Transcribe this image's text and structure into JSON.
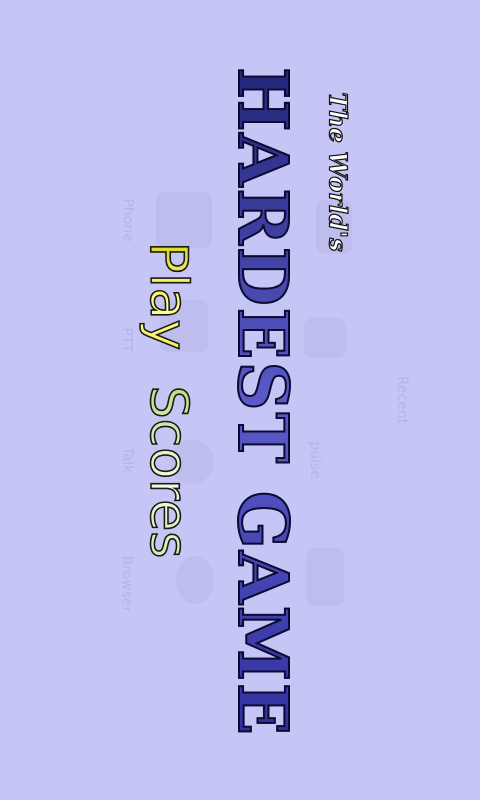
{
  "game": {
    "subtitle": "The World's",
    "title": "HARDEST GAME",
    "menu": {
      "play_label": "Play",
      "scores_label": "Scores"
    }
  },
  "background_icons": {
    "phone": "Phone",
    "ptt": "PTT",
    "talk": "Talk",
    "browser": "Browser",
    "pulse": "pulse",
    "recent": "Recent"
  },
  "colors": {
    "background": "#c6c6f6",
    "title": "#3a3a9a",
    "play": "#f2f24a",
    "scores": "#d8f0b0"
  }
}
